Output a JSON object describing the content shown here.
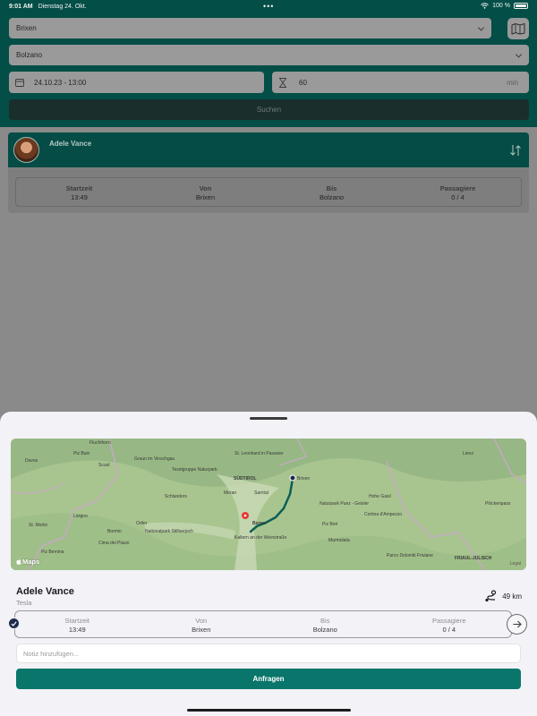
{
  "status_bar": {
    "time": "9:01 AM",
    "date": "Dienstag 24. Okt.",
    "battery": "100 %"
  },
  "search": {
    "from_value": "Brixen",
    "to_value": "Bolzano",
    "datetime_value": "24.10.23 - 13:00",
    "duration_value": "60",
    "duration_unit": "min",
    "search_label": "Suchen"
  },
  "result_card": {
    "driver_name": "Adele Vance",
    "stats": [
      {
        "label": "Startzeit",
        "value": "13:49"
      },
      {
        "label": "Von",
        "value": "Brixen"
      },
      {
        "label": "Bis",
        "value": "Bolzano"
      },
      {
        "label": "Passagiere",
        "value": "0 / 4"
      }
    ]
  },
  "sheet": {
    "map": {
      "logo": "Maps",
      "legal": "Legal",
      "labels": [
        "Fluchthorn",
        "Piz Buin",
        "Davos",
        "Scuol",
        "Graun im Vinschgau",
        "Texelgruppe Naturpark",
        "Meran",
        "Sarntal",
        "St. Leonhard in Passeier",
        "SÜDTIROL",
        "Brixen",
        "Schlanders",
        "Nationalpark Stilfserjoch",
        "Ortler",
        "Bormio",
        "Livigno",
        "Cima dei Piazzi",
        "Piz Bernina",
        "St. Moritz",
        "Bozen",
        "Kaltern an der Weinstraße",
        "Naturpark Puez - Geisler",
        "Piz Boè",
        "Marmolata",
        "Cortina d'Ampezzo",
        "Hohe Gaisl",
        "Lienz",
        "Plöckenpass",
        "FRIAUL-JULISCH",
        "Parco Dolomiti Friulane"
      ]
    },
    "driver_name": "Adele Vance",
    "car": "Tesla",
    "distance": "49 km",
    "stats": [
      {
        "label": "Startzeit",
        "value": "13:49"
      },
      {
        "label": "Von",
        "value": "Brixen"
      },
      {
        "label": "Bis",
        "value": "Bolzano"
      },
      {
        "label": "Passagiere",
        "value": "0 / 4"
      }
    ],
    "note_placeholder": "Notiz hinzufügen...",
    "request_label": "Anfragen"
  },
  "colors": {
    "header_bg": "#034e47",
    "accent": "#0a766b",
    "route": "#0b5f57"
  }
}
